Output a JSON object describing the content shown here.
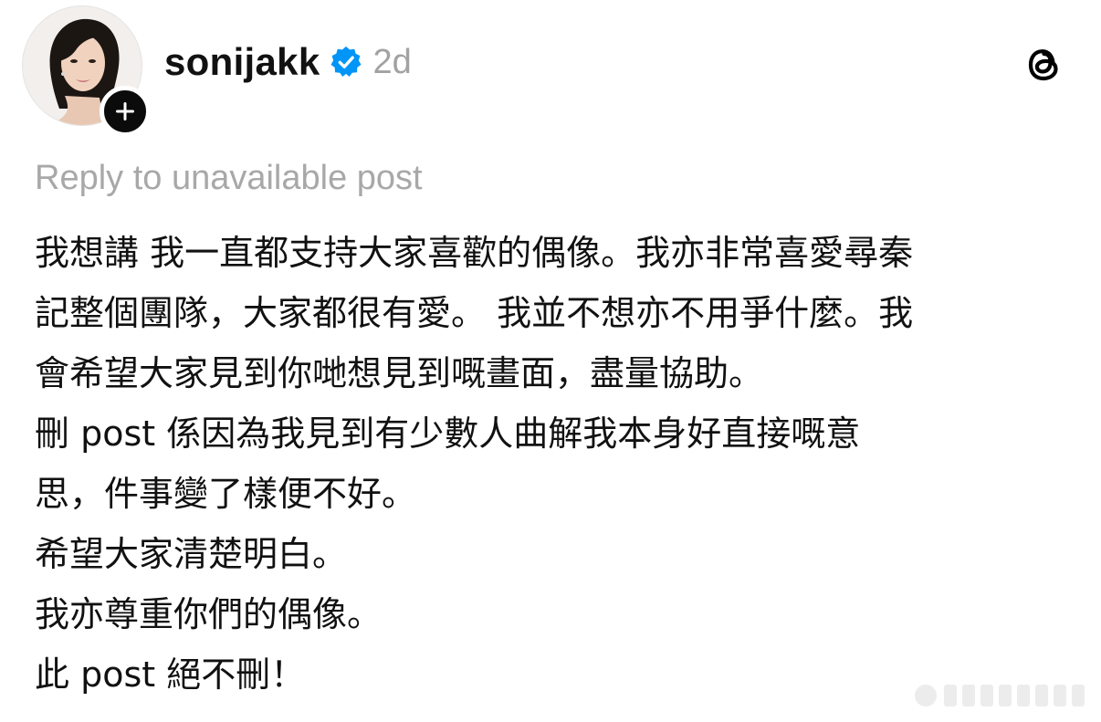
{
  "post": {
    "author": {
      "username": "sonijakk",
      "verified": true,
      "avatar_icon": "profile-photo",
      "follow_icon": "plus-icon"
    },
    "timestamp": "2d",
    "reply_context": "Reply to unavailable post",
    "body_lines": [
      "我想講 我一直都支持大家喜歡的偶像。我亦非常喜愛尋秦",
      "記整個團隊，大家都很有愛。 我並不想亦不用爭什麼。我",
      "會希望大家見到你哋想見到嘅畫面，盡量協助。",
      "刪 post 係因為我見到有少數人曲解我本身好直接嘅意",
      "思，件事變了樣便不好。",
      "希望大家清楚明白。",
      "我亦尊重你們的偶像。",
      "此 post 絕不刪！"
    ]
  },
  "icons": {
    "verified": "verified-badge-icon",
    "app": "threads-logo-icon"
  },
  "colors": {
    "text": "#111111",
    "muted": "#a8a8a8",
    "verified_blue": "#0095f6",
    "badge_black": "#0b0b0b",
    "background": "#ffffff"
  }
}
